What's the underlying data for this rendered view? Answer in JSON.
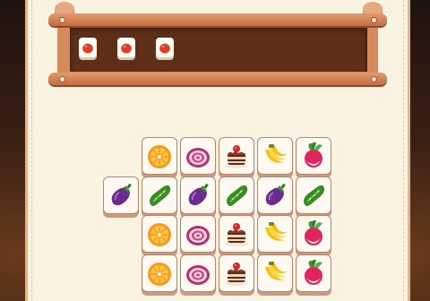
{
  "colors": {
    "board_bg": "#fbf3e2",
    "tray_dark": "#5e2e18",
    "tray_frame": "#d78a5c",
    "tile_face": "#fffaf1",
    "tile_edge": "#c89c80"
  },
  "tray": {
    "capacity_visible": 7,
    "slots": [
      {
        "item": "tomato-icon"
      },
      {
        "item": "tomato-icon"
      },
      {
        "item": "tomato-icon"
      }
    ]
  },
  "board": {
    "tiles": [
      {
        "item": "orange-icon"
      },
      {
        "item": "onion-icon"
      },
      {
        "item": "cake-icon"
      },
      {
        "item": "banana-icon"
      },
      {
        "item": "radish-icon"
      },
      {
        "item": "eggplant-icon"
      },
      {
        "item": "cucumber-icon"
      },
      {
        "item": "eggplant-icon"
      },
      {
        "item": "cucumber-icon"
      },
      {
        "item": "eggplant-icon"
      },
      {
        "item": "cucumber-icon"
      },
      {
        "item": "orange-icon"
      },
      {
        "item": "onion-icon"
      },
      {
        "item": "cake-icon"
      },
      {
        "item": "banana-icon"
      },
      {
        "item": "radish-icon"
      },
      {
        "item": "orange-icon"
      },
      {
        "item": "onion-icon"
      },
      {
        "item": "cake-icon"
      },
      {
        "item": "banana-icon"
      },
      {
        "item": "radish-icon"
      }
    ]
  }
}
